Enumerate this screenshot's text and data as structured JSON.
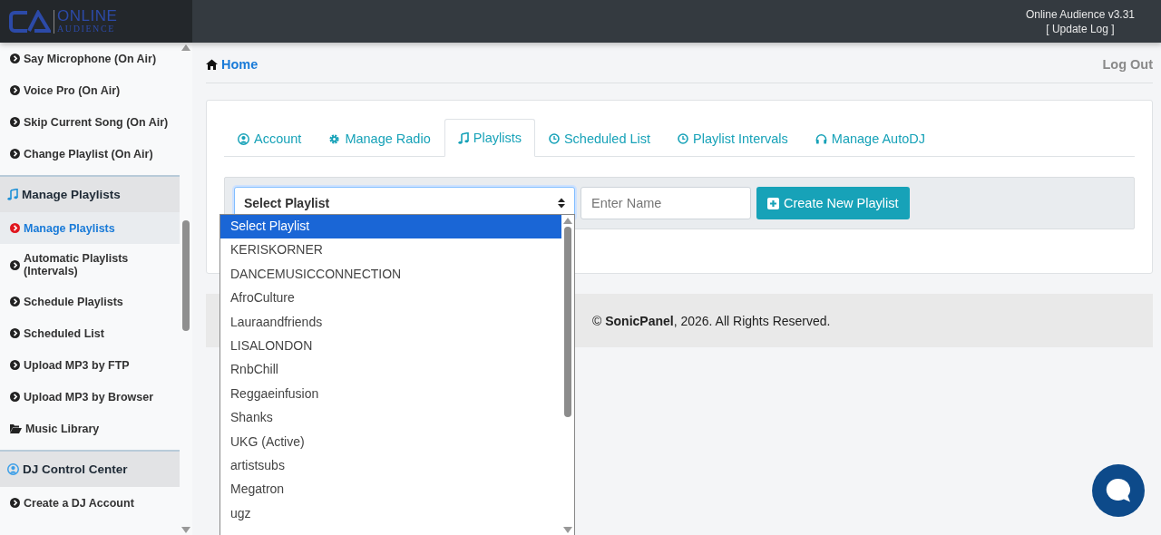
{
  "header": {
    "logo": {
      "line1": "ONLINE",
      "line2": "AUDIENCE"
    },
    "version": "Online Audience v3.31",
    "update_log": "[ Update Log ]"
  },
  "sidebar": {
    "items": [
      {
        "kind": "link",
        "label": "Say Microphone (On Air)",
        "selected": false
      },
      {
        "kind": "link",
        "label": "Voice Pro (On Air)",
        "selected": false
      },
      {
        "kind": "link",
        "label": "Skip Current Song (On Air)",
        "selected": false
      },
      {
        "kind": "link",
        "label": "Change Playlist (On Air)",
        "selected": false
      },
      {
        "kind": "section",
        "label": "Manage Playlists",
        "selected": false
      },
      {
        "kind": "link",
        "label": "Manage Playlists",
        "selected": true
      },
      {
        "kind": "link",
        "label": "Automatic Playlists (Intervals)",
        "selected": false
      },
      {
        "kind": "link",
        "label": "Schedule Playlists",
        "selected": false
      },
      {
        "kind": "link",
        "label": "Scheduled List",
        "selected": false
      },
      {
        "kind": "link",
        "label": "Upload MP3 by FTP",
        "selected": false
      },
      {
        "kind": "link",
        "label": "Upload MP3 by Browser",
        "selected": false
      },
      {
        "kind": "library",
        "label": "Music Library",
        "selected": false
      },
      {
        "kind": "section",
        "label": "DJ Control Center",
        "selected": false
      },
      {
        "kind": "link",
        "label": "Create a DJ Account",
        "selected": false
      }
    ]
  },
  "breadcrumb": "Home",
  "logout": "Log Out",
  "tabs": [
    {
      "label": "Account",
      "selected": false
    },
    {
      "label": "Manage Radio",
      "selected": false
    },
    {
      "label": "Playlists",
      "selected": true
    },
    {
      "label": "Scheduled List",
      "selected": false
    },
    {
      "label": "Playlist Intervals",
      "selected": false
    },
    {
      "label": "Manage AutoDJ",
      "selected": false
    }
  ],
  "playlist_select": {
    "value": "Select Playlist",
    "expanded": true,
    "options": [
      {
        "label": "Select Playlist",
        "selected": true
      },
      {
        "label": "KERISKORNER",
        "selected": false
      },
      {
        "label": "DANCEMUSICCONNECTION",
        "selected": false
      },
      {
        "label": "AfroCulture",
        "selected": false
      },
      {
        "label": "Lauraandfriends",
        "selected": false
      },
      {
        "label": "LISALONDON",
        "selected": false
      },
      {
        "label": "RnbChill",
        "selected": false
      },
      {
        "label": "Reggaeinfusion",
        "selected": false
      },
      {
        "label": "Shanks",
        "selected": false
      },
      {
        "label": "UKG (Active)",
        "selected": false
      },
      {
        "label": "artistsubs",
        "selected": false
      },
      {
        "label": "Megatron",
        "selected": false
      },
      {
        "label": "ugz",
        "selected": false
      }
    ]
  },
  "name_field": {
    "placeholder": "Enter Name"
  },
  "create_button": "Create New Playlist",
  "footer": "© **SonicPanel**, 2026. All Rights Reserved."
}
